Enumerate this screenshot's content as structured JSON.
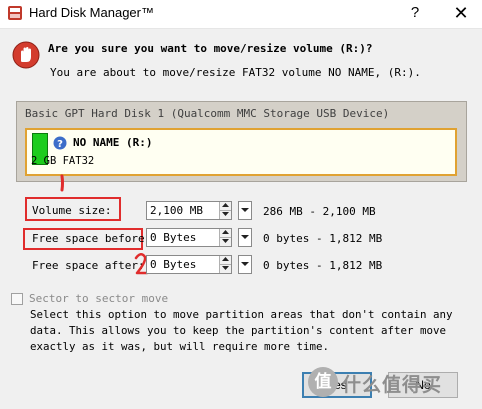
{
  "window": {
    "title": "Hard Disk Manager™",
    "help_glyph": "?",
    "close_glyph": "✕"
  },
  "prompt": {
    "question": "Are you sure you want to move/resize volume (R:)?",
    "subtext": "You are about to move/resize FAT32 volume NO NAME, (R:)."
  },
  "disk": {
    "title": "Basic GPT Hard Disk 1 (Qualcomm MMC Storage USB Device)",
    "partition": {
      "name": "NO NAME (R:)",
      "size": "2 GB FAT32",
      "color": "#1dcc1d",
      "icon": "help-icon"
    }
  },
  "fields": [
    {
      "label": "Volume size:",
      "value": "2,100 MB",
      "range": "286 MB - 2,100 MB"
    },
    {
      "label": "Free space before:",
      "value": "0 Bytes",
      "range": "0 bytes - 1,812 MB"
    },
    {
      "label": "Free space after:",
      "value": "0 Bytes",
      "range": "0 bytes - 1,812 MB"
    }
  ],
  "annotation": {
    "color": "#e02c2c",
    "mark_1": "1",
    "mark_2": "2"
  },
  "sector_option": {
    "label": "Sector to sector move",
    "checked": false,
    "description": "Select this option to move partition areas that don't contain any data. This allows you to keep the partition's content after move exactly as it was, but will require more time."
  },
  "buttons": {
    "yes": "Yes",
    "no": "No"
  },
  "watermark": {
    "badge": "值",
    "text": "什么值得买"
  }
}
